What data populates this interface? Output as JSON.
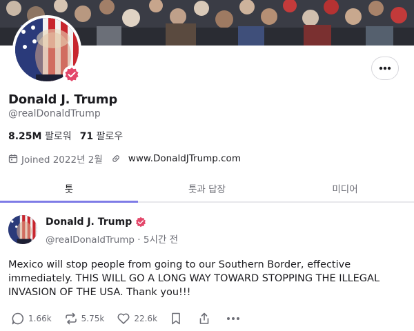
{
  "profile": {
    "display_name": "Donald J. Trump",
    "handle": "@realDonaldTrump",
    "followers_count": "8.25M",
    "followers_label": "팔로워",
    "following_count": "71",
    "following_label": "팔로우",
    "joined": "Joined 2022년 2월",
    "website": "www.DonaldJTrump.com",
    "verified": true
  },
  "tabs": [
    {
      "label": "툿",
      "active": true
    },
    {
      "label": "툿과 답장",
      "active": false
    },
    {
      "label": "미디어",
      "active": false
    }
  ],
  "post": {
    "author": "Donald J. Trump",
    "handle_time": "@realDonaldTrump · 5시간 전",
    "text": "Mexico will stop people from going to our Southern Border, effective immediately. THIS WILL GO A LONG WAY TOWARD STOPPING THE ILLEGAL INVASION OF THE USA. Thank you!!!",
    "replies": "1.66k",
    "reposts": "5.75k",
    "likes": "22.6k"
  },
  "colors": {
    "accent": "#7e7be6",
    "verified": "#e3476a",
    "muted": "#6c6d75"
  },
  "icons": [
    "more-icon",
    "calendar-icon",
    "link-icon",
    "verified-icon",
    "reply-icon",
    "repost-icon",
    "like-icon",
    "bookmark-icon",
    "share-icon",
    "post-more-icon"
  ]
}
